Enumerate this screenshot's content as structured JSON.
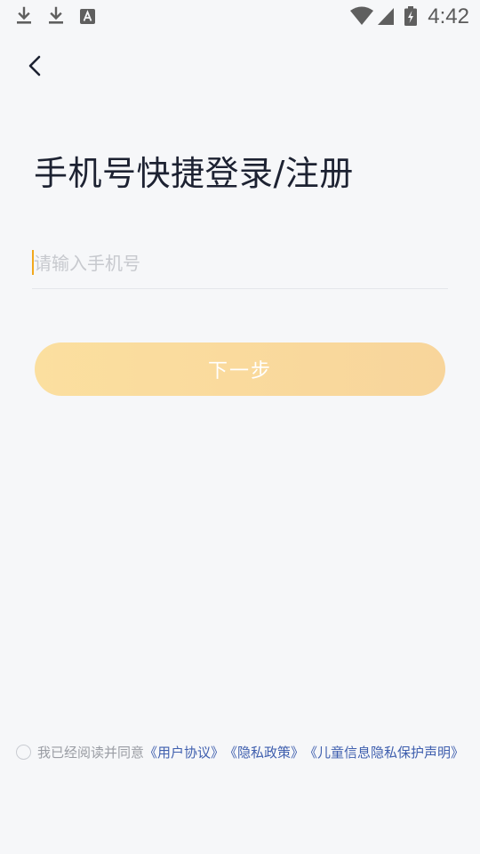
{
  "status_bar": {
    "time": "4:42",
    "notification_icons": [
      "download-icon",
      "download-icon",
      "font-app-icon"
    ],
    "system_icons": [
      "wifi-icon",
      "cell-signal-icon",
      "battery-charging-icon"
    ]
  },
  "nav": {
    "back_icon": "chevron-left-icon"
  },
  "page": {
    "title": "手机号快捷登录/注册"
  },
  "form": {
    "phone_placeholder": "请输入手机号",
    "phone_value": "",
    "next_label": "下一步"
  },
  "agreement": {
    "checked": false,
    "prefix": "我已经阅读并同意",
    "links": [
      "《用户协议》",
      "《隐私政策》",
      "《儿童信息隐私保护声明》"
    ]
  },
  "colors": {
    "background": "#f6f7f9",
    "accent_caret": "#f2a81d",
    "button_gradient_start": "#fbdf9f",
    "button_gradient_end": "#f8d59b",
    "link": "#3f5fae",
    "muted_text": "#9a9da4"
  }
}
